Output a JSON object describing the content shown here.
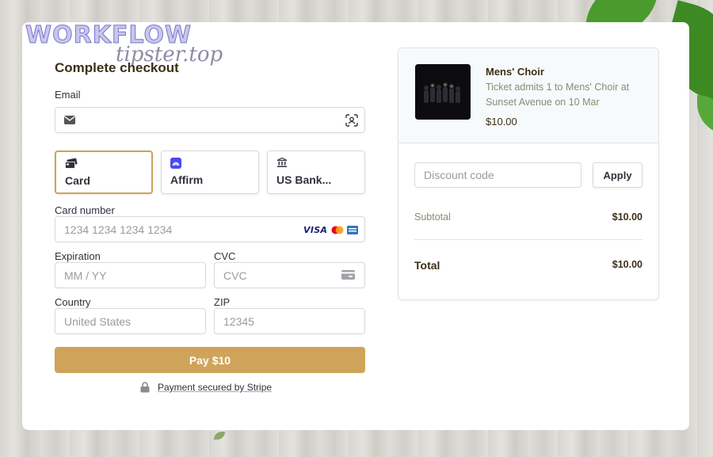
{
  "checkout": {
    "title": "Complete checkout",
    "email_label": "Email",
    "email_value": "",
    "payment_methods": [
      {
        "label": "Card",
        "icon": "card-icon",
        "selected": true
      },
      {
        "label": "Affirm",
        "icon": "affirm-icon",
        "selected": false
      },
      {
        "label": "US Bank...",
        "icon": "bank-icon",
        "selected": false
      }
    ],
    "card_number_label": "Card number",
    "card_number_placeholder": "1234 1234 1234 1234",
    "card_brands": [
      "VISA",
      "mastercard-icon",
      "amex-icon"
    ],
    "expiration_label": "Expiration",
    "expiration_placeholder": "MM / YY",
    "cvc_label": "CVC",
    "cvc_placeholder": "CVC",
    "country_label": "Country",
    "country_value": "United States",
    "zip_label": "ZIP",
    "zip_placeholder": "12345",
    "pay_button": "Pay $10",
    "secured_text": "Payment secured by Stripe"
  },
  "watermark": {
    "top": "WORKFLOW",
    "bottom": "tipster.top"
  },
  "summary": {
    "product_name": "Mens' Choir",
    "product_description": "Ticket admits 1 to Mens' Choir at Sunset Avenue on 10 Mar",
    "product_price": "$10.00",
    "discount_placeholder": "Discount code",
    "apply_label": "Apply",
    "subtotal_label": "Subtotal",
    "subtotal_value": "$10.00",
    "total_label": "Total",
    "total_value": "$10.00"
  },
  "colors": {
    "accent": "#cfa45a",
    "selected_border": "#c9a45a",
    "heading": "#3b3016"
  }
}
